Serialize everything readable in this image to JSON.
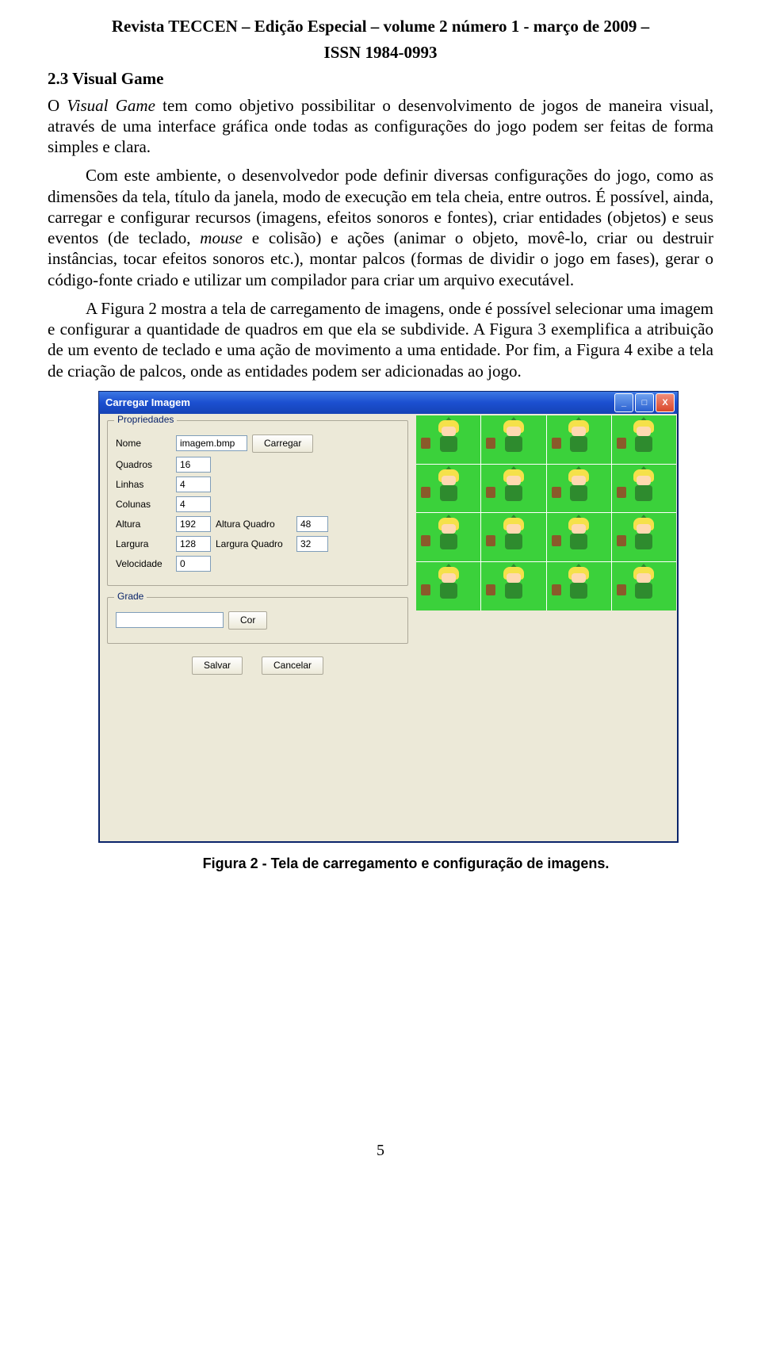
{
  "header": {
    "line1": "Revista TECCEN – Edição Especial – volume 2 número 1 - março de 2009 –",
    "line2": "ISSN 1984-0993"
  },
  "section": "2.3   Visual Game",
  "paragraphs": {
    "p1a": "O ",
    "p1b": "Visual Game",
    "p1c": " tem como objetivo possibilitar o desenvolvimento de jogos de maneira visual, através de uma interface gráfica onde todas as configurações do jogo podem ser feitas de forma simples e clara.",
    "p2": "Com este ambiente, o desenvolvedor pode definir diversas configurações do jogo, como as dimensões da tela, título da janela, modo de execução em tela cheia, entre outros. É possível, ainda, carregar e configurar recursos (imagens, efeitos sonoros e fontes), criar entidades (objetos) e seus eventos (de teclado, ",
    "p2b": "mouse",
    "p2c": " e colisão) e ações (animar o objeto, movê-lo, criar ou destruir instâncias, tocar efeitos sonoros etc.), montar palcos (formas de dividir o jogo em fases), gerar o código-fonte criado e utilizar um compilador para criar um arquivo executável.",
    "p3": "A Figura 2 mostra a tela de carregamento de imagens, onde é possível selecionar uma imagem e configurar a quantidade de quadros em que ela se subdivide.  A Figura 3 exemplifica a atribuição de um evento de teclado e uma ação de movimento a uma entidade.  Por fim, a Figura 4 exibe a tela de criação de palcos, onde as entidades podem ser adicionadas ao jogo."
  },
  "window": {
    "title": "Carregar Imagem",
    "min": "_",
    "max": "□",
    "close": "X",
    "group_props": "Propriedades",
    "group_grade": "Grade",
    "labels": {
      "nome": "Nome",
      "quadros": "Quadros",
      "linhas": "Linhas",
      "colunas": "Colunas",
      "altura": "Altura",
      "largura": "Largura",
      "velocidade": "Velocidade",
      "altura_quadro": "Altura Quadro",
      "largura_quadro": "Largura Quadro"
    },
    "values": {
      "nome": "imagem.bmp",
      "quadros": "16",
      "linhas": "4",
      "colunas": "4",
      "altura": "192",
      "largura": "128",
      "velocidade": "0",
      "altura_quadro": "48",
      "largura_quadro": "32",
      "grade_val": ""
    },
    "buttons": {
      "carregar": "Carregar",
      "cor": "Cor",
      "salvar": "Salvar",
      "cancelar": "Cancelar"
    }
  },
  "caption": "Figura 2 - Tela de carregamento e configuração de imagens.",
  "page_number": "5"
}
